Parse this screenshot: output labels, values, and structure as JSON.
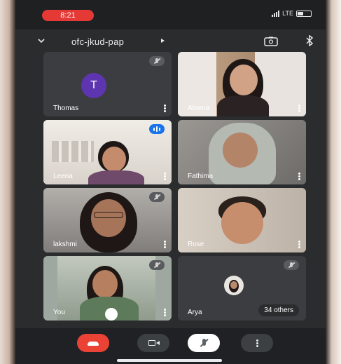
{
  "status_bar": {
    "time": "8:21",
    "network": "LTE"
  },
  "header": {
    "meeting_code": "ofc-jkud-pap"
  },
  "participants": [
    {
      "name": "Thomas",
      "initial": "T",
      "muted": true
    },
    {
      "name": "Aleena",
      "muted": false
    },
    {
      "name": "Leena",
      "speaking": true
    },
    {
      "name": "Fathima",
      "muted": false
    },
    {
      "name": "lakshmi",
      "muted": true
    },
    {
      "name": "Rose",
      "muted": false
    },
    {
      "name": "You",
      "muted": true
    },
    {
      "name": "Arya",
      "muted": true
    }
  ],
  "others_count_label": "34 others",
  "colors": {
    "end_call": "#ea4335",
    "avatar_thomas": "#5e35b1",
    "speaking_badge": "#1a73e8",
    "time_pill": "#e53935"
  },
  "icons": [
    "chevron-down-icon",
    "camera-switch-icon",
    "bluetooth-icon",
    "end-call-icon",
    "camera-icon",
    "mic-off-icon",
    "more-options-icon"
  ]
}
